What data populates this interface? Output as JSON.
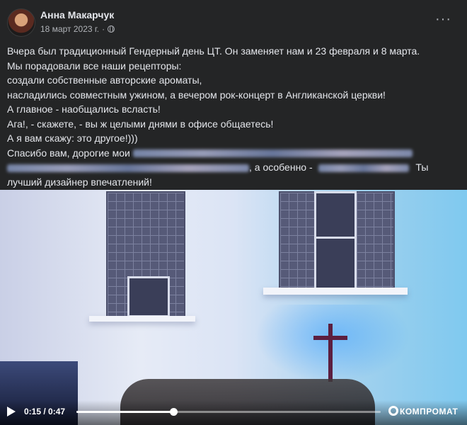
{
  "post": {
    "author": "Анна Макарчук",
    "date": "18 март 2023 г.",
    "separator": "·",
    "more": "···",
    "lines": [
      "Вчера был традиционный Гендерный день ЦТ. Он заменяет нам и  23 февраля и 8 марта.",
      "Мы порадовали все наши рецепторы:",
      "создали собственные  авторские ароматы,",
      "насладились совместным ужином, а вечером рок-концерт в Англиканской церкви!",
      "А главное - наобщались всласть!",
      "Ага!, - скажете, - вы ж целыми днями в офисе общаетесь!",
      "А я вам скажу: это другое!)))"
    ],
    "thanks_prefix": "Спасибо вам, дорогие мои",
    "especially": ", а особенно -",
    "you": "Ты",
    "last_line": "лучший дизайнер впечатлений!"
  },
  "video": {
    "current_time": "0:15",
    "total_time": "0:47",
    "time_sep": " / ",
    "progress": 0.319,
    "watermark": "КОМПРОМАТ"
  },
  "colors": {
    "background": "#242526",
    "text": "#e4e6eb",
    "secondary": "#b0b3b8"
  },
  "icons": [
    "avatar",
    "globe-icon",
    "more-icon",
    "play-icon",
    "settings-icon"
  ]
}
